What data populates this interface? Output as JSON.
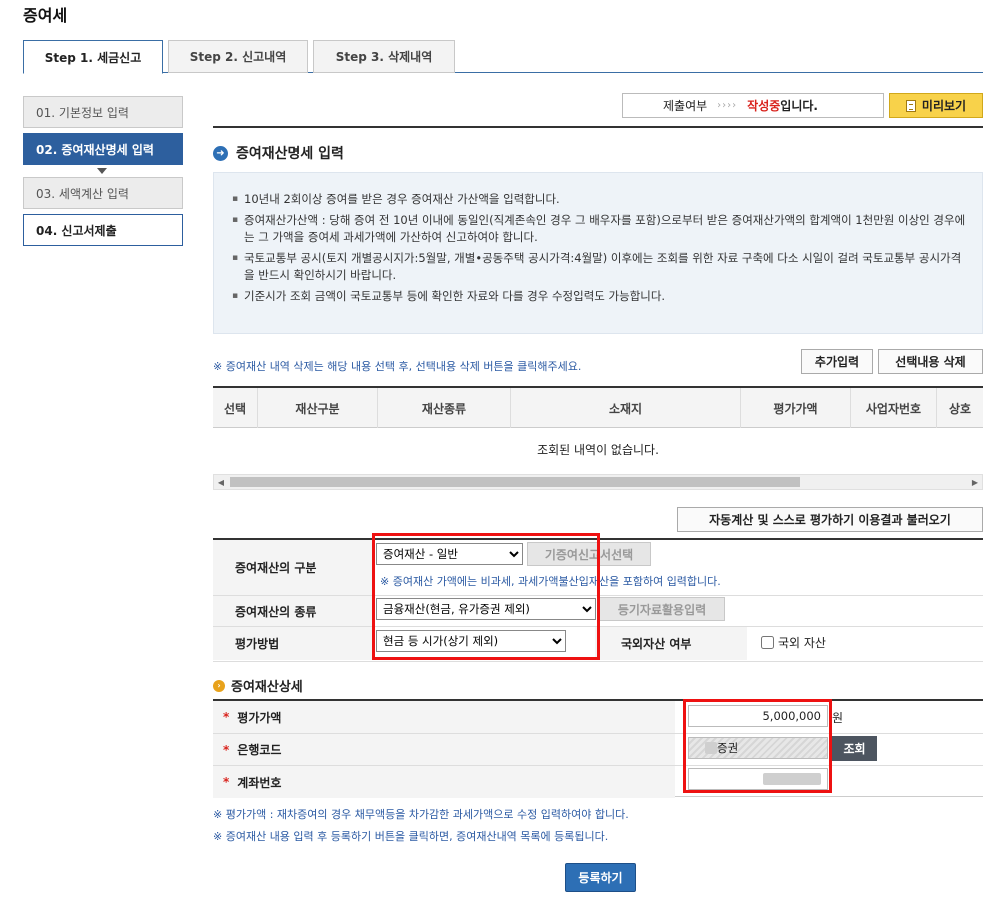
{
  "app_title": "증여세",
  "tabs": [
    {
      "label": "Step 1. 세금신고"
    },
    {
      "label": "Step 2. 신고내역"
    },
    {
      "label": "Step 3. 삭제내역"
    }
  ],
  "sidebar": {
    "items": [
      {
        "label": "01. 기본정보 입력"
      },
      {
        "label": "02. 증여재산명세 입력"
      },
      {
        "label": "03. 세액계산 입력"
      },
      {
        "label": "04. 신고서제출"
      }
    ]
  },
  "status": {
    "label": "제출여부",
    "arrows": "››››",
    "state_highlight": "작성중",
    "state_suffix": "입니다."
  },
  "preview_button": "미리보기",
  "section_title": "증여재산명세 입력",
  "info_items": [
    "10년내 2회이상 증여를 받은 경우 증여재산 가산액을 입력합니다.",
    "증여재산가산액 : 당해 증여 전 10년 이내에 동일인(직계존속인 경우 그 배우자를 포함)으로부터 받은 증여재산가액의 합계액이 1천만원 이상인 경우에는 그 가액을 증여세 과세가액에 가산하여 신고하여야 합니다.",
    "국토교통부 공시(토지 개별공시지가:5월말, 개별•공동주택 공시가격:4월말) 이후에는 조회를 위한 자료 구축에 다소 시일이 걸려 국토교통부 공시가격을 반드시 확인하시기 바랍니다.",
    "기준시가 조회 금액이 국토교통부 등에 확인한 자료와 다를 경우 수정입력도 가능합니다."
  ],
  "delete_note": "※ 증여재산 내역 삭제는 해당 내용 선택 후, 선택내용 삭제 버튼을  클릭해주세요.",
  "buttons": {
    "add": "추가입력",
    "delete_selected": "선택내용 삭제",
    "auto_calc": "자동계산 및 스스로 평가하기 이용결과 불러오기",
    "prior_gift": "기증여신고서선택",
    "registry": "등기자료활용입력",
    "lookup": "조회",
    "register": "등록하기"
  },
  "table": {
    "columns": [
      "선택",
      "재산구분",
      "재산종류",
      "소재지",
      "평가가액",
      "사업자번호",
      "상호"
    ],
    "empty_message": "조회된 내역이 없습니다."
  },
  "form": {
    "category_label": "증여재산의 구분",
    "category_value": "증여재산 - 일반",
    "category_note": "※ 증여재산 가액에는 비과세, 과세가액불산입재산을 포함하여 입력합니다.",
    "type_label": "증여재산의 종류",
    "type_value": "금융재산(현금, 유가증권 제외)",
    "method_label": "평가방법",
    "method_value": "현금 등 시가(상기 제외)",
    "foreign_label": "국외자산 여부",
    "foreign_checkbox_label": "국외 자산"
  },
  "detail": {
    "title": "증여재산상세",
    "required_mark": "*",
    "amount_label": "평가가액",
    "amount_value": "5,000,000",
    "amount_unit": "원",
    "bank_label": "은행코드",
    "bank_value_suffix": "증권",
    "account_label": "계좌번호"
  },
  "footnotes": [
    "※ 평가가액 : 재차증여의 경우 채무액등을 차가감한 과세가액으로 수정 입력하여야 합니다.",
    "※ 증여재산 내용 입력 후 등록하기 버튼을 클릭하면, 증여재산내역 목록에 등록됩니다."
  ],
  "colors": {
    "accent_blue": "#2d5f9e",
    "highlight_red": "#e11111",
    "preview_yellow": "#f8d24a"
  }
}
